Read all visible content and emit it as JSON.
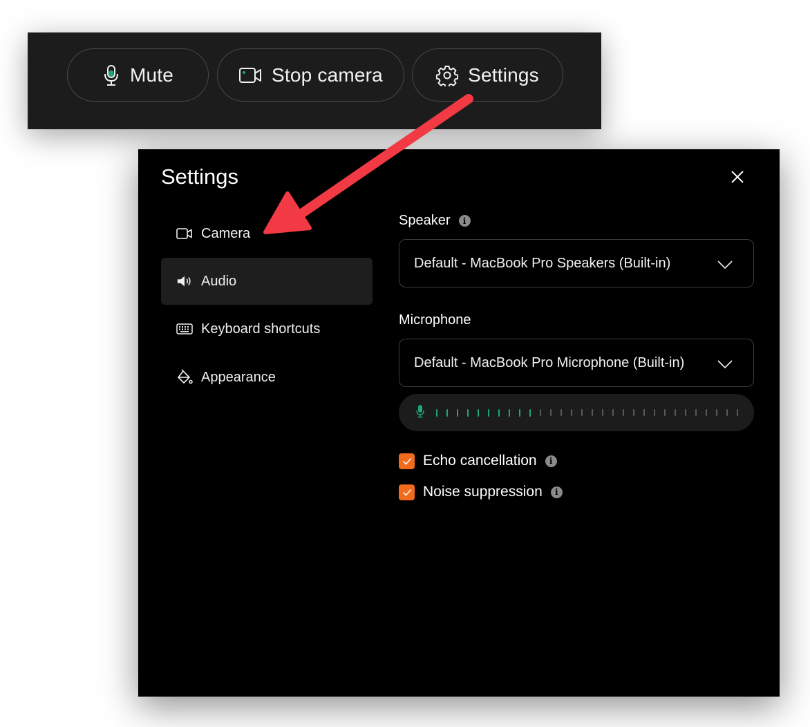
{
  "toolbar": {
    "mute_label": "Mute",
    "stop_camera_label": "Stop camera",
    "settings_label": "Settings"
  },
  "dialog": {
    "title": "Settings",
    "nav": {
      "camera": "Camera",
      "audio": "Audio",
      "keyboard": "Keyboard shortcuts",
      "appearance": "Appearance",
      "active": "audio"
    },
    "speaker": {
      "label": "Speaker",
      "value": "Default - MacBook Pro Speakers (Built-in)"
    },
    "microphone": {
      "label": "Microphone",
      "value": "Default - MacBook Pro Microphone (Built-in)",
      "level_active_bars": 10,
      "level_total_bars": 30
    },
    "echo_cancellation": {
      "label": "Echo cancellation",
      "checked": true
    },
    "noise_suppression": {
      "label": "Noise suppression",
      "checked": true
    }
  },
  "colors": {
    "accent_orange": "#f26b1d",
    "meter_green": "#1fa57c",
    "annotation_red": "#f23a44",
    "dialog_bg": "#000000",
    "toolbar_bg": "#1c1c1c"
  },
  "icons": {
    "mute": "microphone-icon",
    "camera": "video-camera-icon",
    "settings": "gear-icon",
    "close": "close-icon",
    "audio": "speaker-icon",
    "keyboard": "keyboard-icon",
    "appearance": "paint-bucket-icon",
    "info": "info-icon",
    "chevron": "chevron-down-icon"
  }
}
